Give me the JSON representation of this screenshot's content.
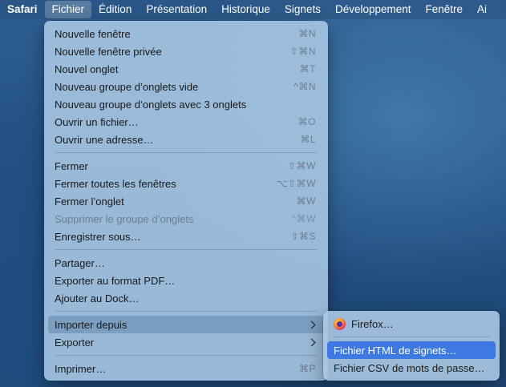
{
  "menubar": {
    "items": [
      "Safari",
      "Fichier",
      "Édition",
      "Présentation",
      "Historique",
      "Signets",
      "Développement",
      "Fenêtre",
      "Ai"
    ]
  },
  "file_menu": {
    "groups": [
      [
        {
          "label": "Nouvelle fenêtre",
          "shortcut": "⌘N"
        },
        {
          "label": "Nouvelle fenêtre privée",
          "shortcut": "⇧⌘N"
        },
        {
          "label": "Nouvel onglet",
          "shortcut": "⌘T"
        },
        {
          "label": "Nouveau groupe d’onglets vide",
          "shortcut": "^⌘N"
        },
        {
          "label": "Nouveau groupe d’onglets avec 3 onglets",
          "shortcut": ""
        },
        {
          "label": "Ouvrir un fichier…",
          "shortcut": "⌘O"
        },
        {
          "label": "Ouvrir une adresse…",
          "shortcut": "⌘L"
        }
      ],
      [
        {
          "label": "Fermer",
          "shortcut": "⇧⌘W"
        },
        {
          "label": "Fermer toutes les fenêtres",
          "shortcut": "⌥⇧⌘W"
        },
        {
          "label": "Fermer l’onglet",
          "shortcut": "⌘W"
        },
        {
          "label": "Supprimer le groupe d’onglets",
          "shortcut": "^⌘W",
          "disabled": true
        },
        {
          "label": "Enregistrer sous…",
          "shortcut": "⇧⌘S"
        }
      ],
      [
        {
          "label": "Partager…",
          "shortcut": ""
        },
        {
          "label": "Exporter au format PDF…",
          "shortcut": ""
        },
        {
          "label": "Ajouter au Dock…",
          "shortcut": ""
        }
      ],
      [
        {
          "label": "Importer depuis",
          "submenu": true
        },
        {
          "label": "Exporter",
          "submenu": true
        }
      ],
      [
        {
          "label": "Imprimer…",
          "shortcut": "⌘P"
        }
      ]
    ]
  },
  "import_submenu": {
    "firefox": "Firefox…",
    "html_bookmarks": "Fichier HTML de signets…",
    "csv_passwords": "Fichier CSV de mots de passe…"
  },
  "colors": {
    "selection": "#3d79e0"
  }
}
